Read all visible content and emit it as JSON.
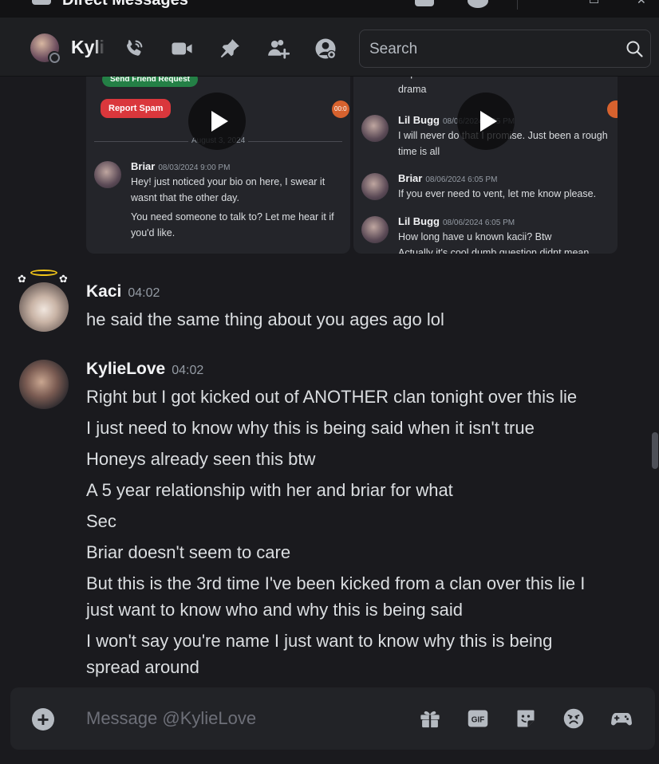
{
  "window": {
    "title": "Direct Messages"
  },
  "header": {
    "username": "KylieLove",
    "search_placeholder": "Search"
  },
  "embed": {
    "left": {
      "friend_button": "Send Friend Request",
      "report_button": "Report Spam",
      "timer_label": "00:0",
      "date_divider": "August 3, 2024",
      "message": {
        "author": "Briar",
        "timestamp": "08/03/2024 9:00 PM",
        "lines": [
          "Hey! just noticed your bio on here, I swear it wasnt that the other day.",
          "You need someone to talk to? Let me hear it if you'd like."
        ]
      }
    },
    "right": {
      "top_text": "requirements in the clan other than not to cause drama",
      "messages": [
        {
          "author": "Lil Bugg",
          "timestamp": "08/06/2024 6:05 PM",
          "text": "I will never do that I promise. Just been a rough time is all"
        },
        {
          "author": "Briar",
          "timestamp": "08/06/2024 6:05 PM",
          "text": "If you ever need to vent, let me know please."
        },
        {
          "author": "Lil Bugg",
          "timestamp": "08/06/2024 6:05 PM",
          "text": "How long have u known kacii? Btw"
        }
      ],
      "trailing_text": "Actually it's cool dumb question didnt mean"
    }
  },
  "messages": [
    {
      "author": "Kaci",
      "time": "04:02",
      "lines": [
        "he said the same thing about you ages ago lol"
      ]
    },
    {
      "author": "KylieLove",
      "time": "04:02",
      "lines": [
        "Right but I got kicked out of ANOTHER clan tonight over this lie",
        "I just need to know why this is being said when it isn't true",
        "Honeys already seen this btw",
        "A 5 year relationship with her and briar for what",
        "Sec",
        "Briar doesn't seem to care",
        "But this is the 3rd time I've been kicked from a clan over this lie I just want to know who and why this is being said",
        "I won't say you're name I just want to know why this is being spread around"
      ]
    }
  ],
  "composer": {
    "placeholder": "Message @KylieLove",
    "plus_label": "+",
    "gif_label": "GIF"
  },
  "icons": {
    "header": [
      "call-icon",
      "video-icon",
      "pin-icon",
      "add-friend-icon",
      "profile-icon",
      "search-icon"
    ],
    "composer": [
      "plus-icon",
      "gift-icon",
      "gif-icon",
      "sticker-icon",
      "emoji-icon",
      "apps-icon"
    ]
  },
  "colors": {
    "background": "#1a1a1e",
    "header": "#1e1f22",
    "composer": "#222327",
    "text": "#dbdee1",
    "muted": "#949ba4",
    "green": "#248046",
    "red": "#da373c"
  }
}
